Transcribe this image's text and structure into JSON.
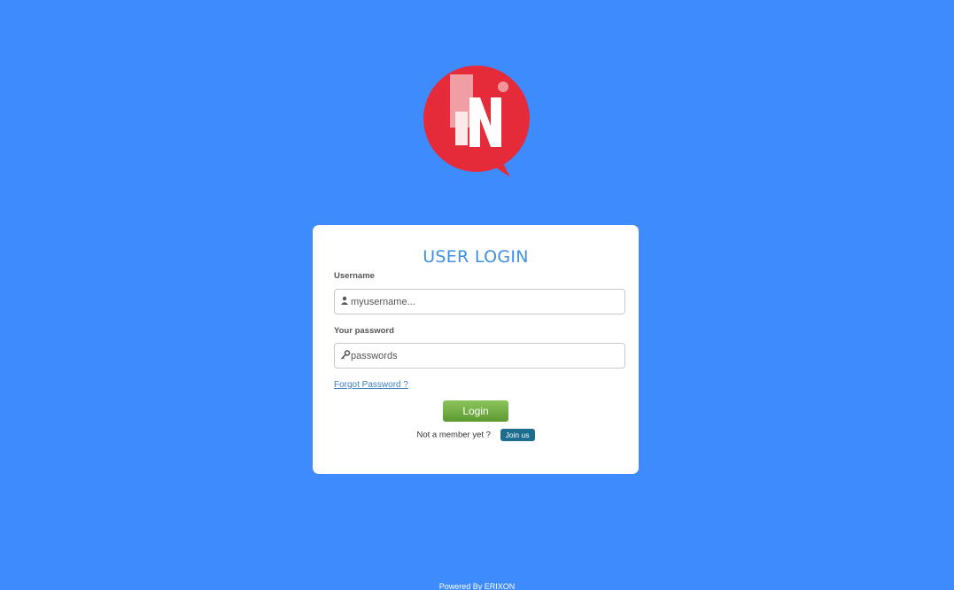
{
  "logo": {
    "name": "brand-logo",
    "letter": "N",
    "color": "#e52b3a"
  },
  "login": {
    "title": "USER LOGIN",
    "username": {
      "label": "Username",
      "placeholder": "myusername...",
      "value": "",
      "icon": "user-icon"
    },
    "password": {
      "label": "Your password",
      "placeholder": "passwords",
      "value": "",
      "icon": "key-icon"
    },
    "forgot_label": "Forgot Password ?",
    "login_label": "Login",
    "not_member_text": "Not a member yet ?",
    "join_label": "Join us"
  },
  "footer": {
    "text": "Powered By ERIXON"
  },
  "colors": {
    "background": "#3d8bfd",
    "title": "#3f8fe4",
    "login_button": "#6aa83c",
    "join_button": "#1d6d8f"
  }
}
